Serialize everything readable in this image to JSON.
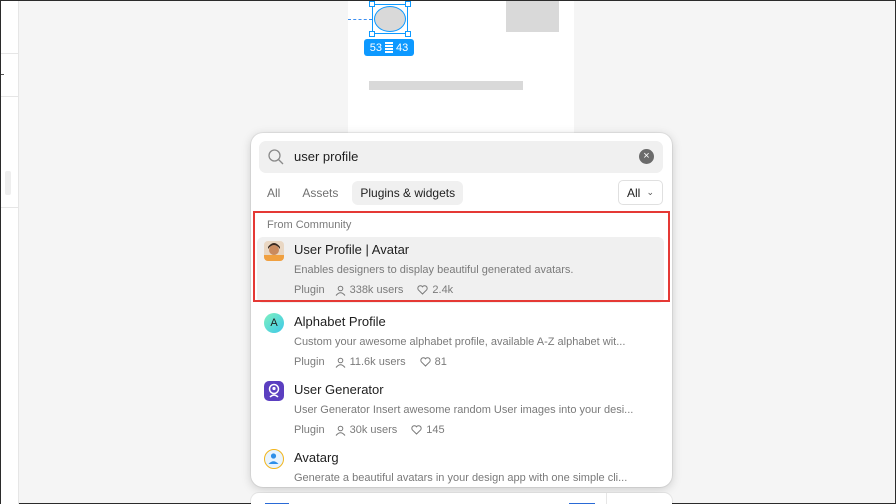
{
  "canvas": {
    "selection_size": {
      "width": "53",
      "height": "43"
    }
  },
  "search": {
    "value": "user profile",
    "clear_label": "×"
  },
  "tabs": [
    {
      "label": "All"
    },
    {
      "label": "Assets"
    },
    {
      "label": "Plugins & widgets"
    }
  ],
  "filter": {
    "label": "All"
  },
  "section_title": "From Community",
  "results": [
    {
      "name": "User Profile | Avatar",
      "description": "Enables designers to display beautiful generated avatars.",
      "kind": "Plugin",
      "users": "338k users",
      "likes": "2.4k"
    },
    {
      "name": "Alphabet Profile",
      "description": "Custom your awesome alphabet profile, available A-Z alphabet wit...",
      "kind": "Plugin",
      "users": "11.6k users",
      "likes": "81",
      "avatar_letter": "A"
    },
    {
      "name": "User Generator",
      "description": "User Generator Insert awesome random User images into your desi...",
      "kind": "Plugin",
      "users": "30k users",
      "likes": "145"
    },
    {
      "name": "Avatarg",
      "description": "Generate a beautiful avatars in your design app with one simple cli...",
      "kind": "",
      "users": "",
      "likes": ""
    }
  ],
  "colors": {
    "accent": "#0d99ff",
    "highlight_border": "#e53935"
  }
}
